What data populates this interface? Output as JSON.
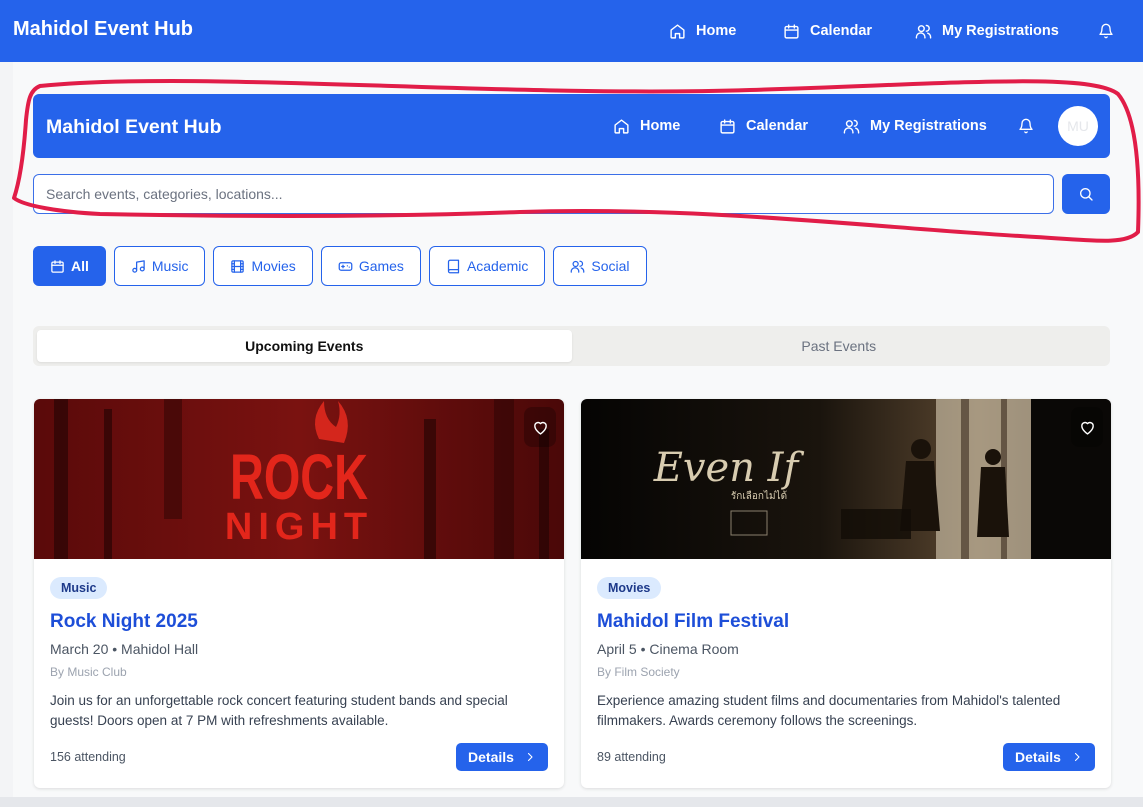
{
  "app": {
    "title": "Mahidol Event Hub"
  },
  "nav": {
    "home": "Home",
    "calendar": "Calendar",
    "registrations": "My Registrations"
  },
  "user": {
    "initials": "MU"
  },
  "search": {
    "placeholder": "Search events, categories, locations...",
    "value": ""
  },
  "categories": [
    {
      "label": "All",
      "icon": "calendar-icon",
      "active": true
    },
    {
      "label": "Music",
      "icon": "music-icon"
    },
    {
      "label": "Movies",
      "icon": "film-icon"
    },
    {
      "label": "Games",
      "icon": "gamepad-icon"
    },
    {
      "label": "Academic",
      "icon": "book-icon"
    },
    {
      "label": "Social",
      "icon": "users-icon"
    }
  ],
  "tabs": [
    {
      "label": "Upcoming Events",
      "active": true
    },
    {
      "label": "Past Events"
    }
  ],
  "events": [
    {
      "category": "Music",
      "title": "Rock Night 2025",
      "meta": "March 20 • Mahidol Hall",
      "organizer": "By Music Club",
      "description": "Join us for an unforgettable rock concert featuring student bands and special guests! Doors open at 7 PM with refreshments available.",
      "attending": "156 attending",
      "details_label": "Details",
      "poster": {
        "line1": "ROCK",
        "line2": "NIGHT"
      }
    },
    {
      "category": "Movies",
      "title": "Mahidol Film Festival",
      "meta": "April 5 • Cinema Room",
      "organizer": "By Film Society",
      "description": "Experience amazing student films and documentaries from Mahidol's talented filmmakers. Awards ceremony follows the screenings.",
      "attending": "89 attending",
      "details_label": "Details",
      "poster": {
        "title": "Even If",
        "subtitle": "รักเลือกไม่ได้"
      }
    }
  ],
  "colors": {
    "primary": "#2563eb",
    "annotation": "#e11d48"
  }
}
